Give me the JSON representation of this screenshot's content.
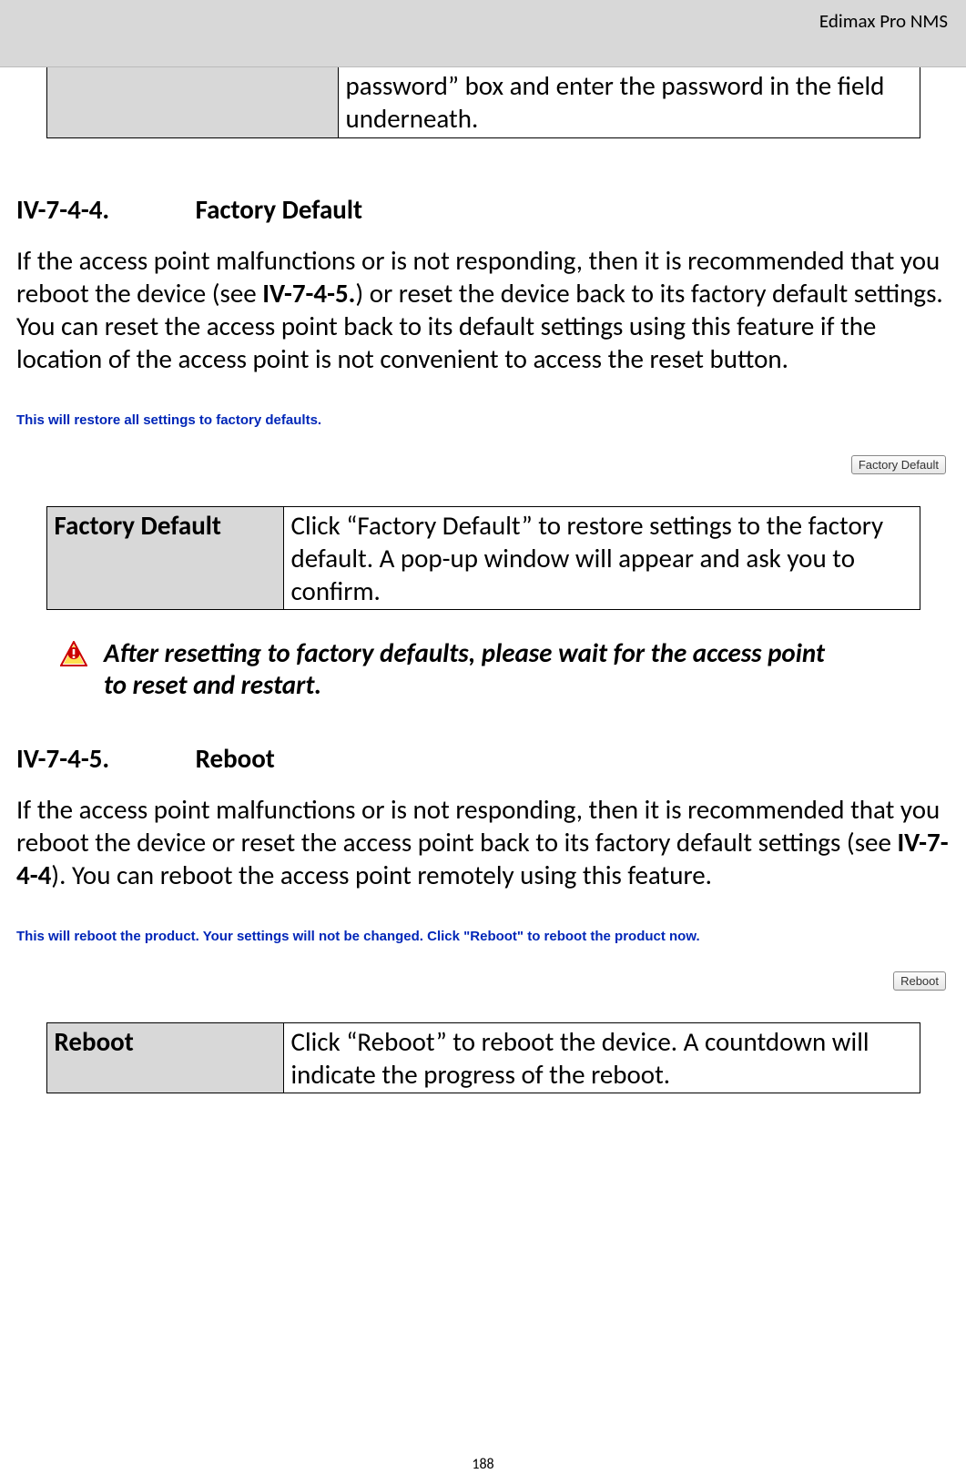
{
  "header": "Edimax Pro NMS",
  "fragTable": {
    "right": "password” box and enter the password in the field underneath."
  },
  "section1": {
    "num": "IV-7-4-4.",
    "title": "Factory Default",
    "p1a": "If the access point malfunctions or is not responding, then it is recommended that you reboot the device (see ",
    "p1b": "IV-7-4-5.",
    "p1c": ") or reset the device back to its factory default settings. You can reset the access point back to its default settings using this feature if the location of the access point is not convenient to access the reset button.",
    "screenshot_caption": "This will restore all settings to factory defaults.",
    "screenshot_button": "Factory Default",
    "table_left": "Factory Default",
    "table_right": "Click “Factory Default” to restore settings to the factory default. A pop-up window will appear and ask you to confirm.",
    "warning": "After resetting to factory defaults, please wait for the access point to reset and restart."
  },
  "section2": {
    "num": "IV-7-4-5.",
    "title": "Reboot",
    "p1a": "If the access point malfunctions or is not responding, then it is recommended that you reboot the device or reset the access point back to its factory default settings (see ",
    "p1b": "IV-7-4-4",
    "p1c": "). You can reboot the access point remotely using this feature.",
    "screenshot_caption": "This will reboot the product. Your settings will not be changed. Click \"Reboot\" to reboot the product now.",
    "screenshot_button": "Reboot",
    "table_left": "Reboot",
    "table_right": "Click “Reboot” to reboot the device. A countdown will indicate the progress of the reboot."
  },
  "pageNumber": "188"
}
